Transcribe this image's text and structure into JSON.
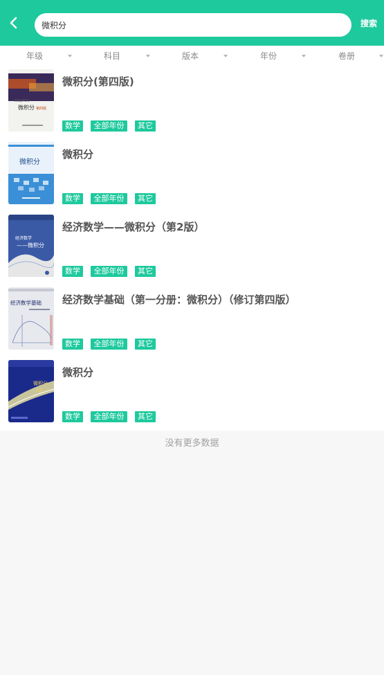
{
  "search": {
    "value": "微积分",
    "button_label": "搜索"
  },
  "icons": {
    "back": "chevron-left-icon",
    "filter_caret": "caret-down-icon"
  },
  "colors": {
    "brand": "#1ec99d",
    "tag_text": "#ffffff",
    "title_text": "#555555"
  },
  "filters": [
    {
      "label": "年级"
    },
    {
      "label": "科目"
    },
    {
      "label": "版本"
    },
    {
      "label": "年份"
    },
    {
      "label": "卷册"
    }
  ],
  "books": [
    {
      "title": "微积分(第四版)",
      "tags": [
        "数学",
        "全部年份",
        "其它"
      ],
      "cover": {
        "text": "微积分",
        "badge": "第四版",
        "latin": "WEIJIFEN"
      }
    },
    {
      "title": "微积分",
      "tags": [
        "数学",
        "全部年份",
        "其它"
      ],
      "cover": {
        "text": "微积分"
      }
    },
    {
      "title": "经济数学——微积分（第2版）",
      "tags": [
        "数学",
        "全部年份",
        "其它"
      ],
      "cover": {
        "text": "经济数学",
        "text2": "——微积分"
      }
    },
    {
      "title": "经济数学基础（第一分册：微积分）（修订第四版）",
      "tags": [
        "数学",
        "全部年份",
        "其它"
      ],
      "cover": {
        "text": "经济数学基础"
      }
    },
    {
      "title": "微积分",
      "tags": [
        "数学",
        "全部年份",
        "其它"
      ],
      "cover": {
        "text": "微积分",
        "text2": "简明"
      }
    }
  ],
  "list_end_text": "没有更多数据"
}
